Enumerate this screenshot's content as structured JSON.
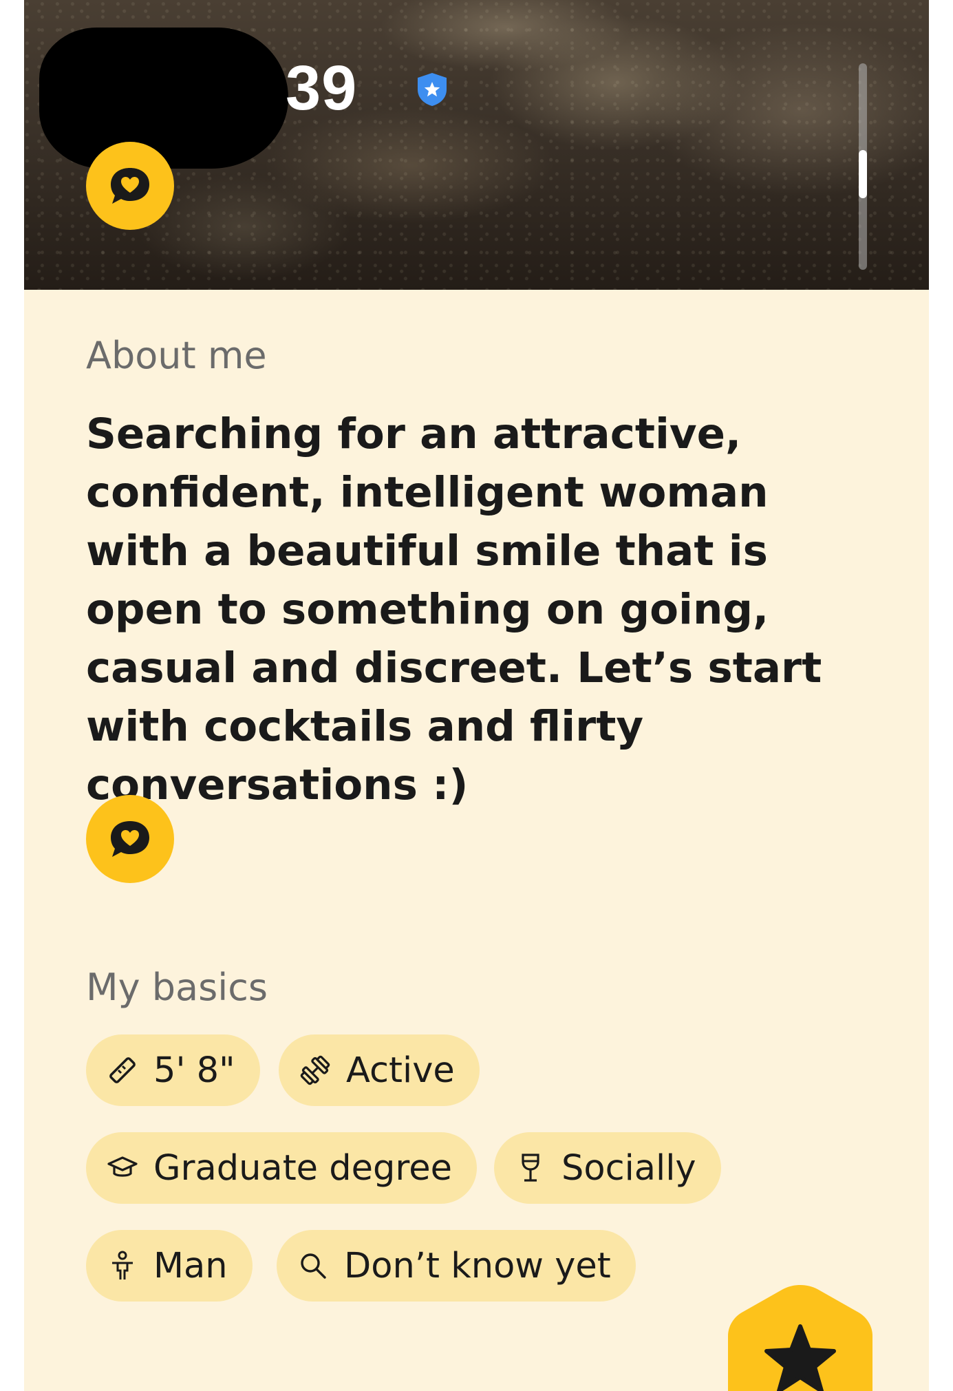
{
  "profile": {
    "age": "39"
  },
  "about": {
    "heading": "About me",
    "text": "Searching for an attractive, confident, intelligent woman with a beautiful smile that is open to something on going, casual and discreet. Let’s start with cocktails and flirty conversations :)"
  },
  "basics": {
    "heading": "My basics",
    "chips": [
      {
        "icon": "ruler-icon",
        "label": "5' 8\""
      },
      {
        "icon": "dumbbell-icon",
        "label": "Active"
      },
      {
        "icon": "graduation-cap-icon",
        "label": "Graduate degree"
      },
      {
        "icon": "wine-glass-icon",
        "label": "Socially"
      },
      {
        "icon": "person-icon",
        "label": "Man"
      },
      {
        "icon": "magnifier-icon",
        "label": "Don’t know yet"
      }
    ]
  },
  "colors": {
    "card_background": "#fdf3dc",
    "accent_yellow": "#fdc21b",
    "chip_background": "#fbe6a6",
    "verified_blue": "#3d8ef0"
  }
}
